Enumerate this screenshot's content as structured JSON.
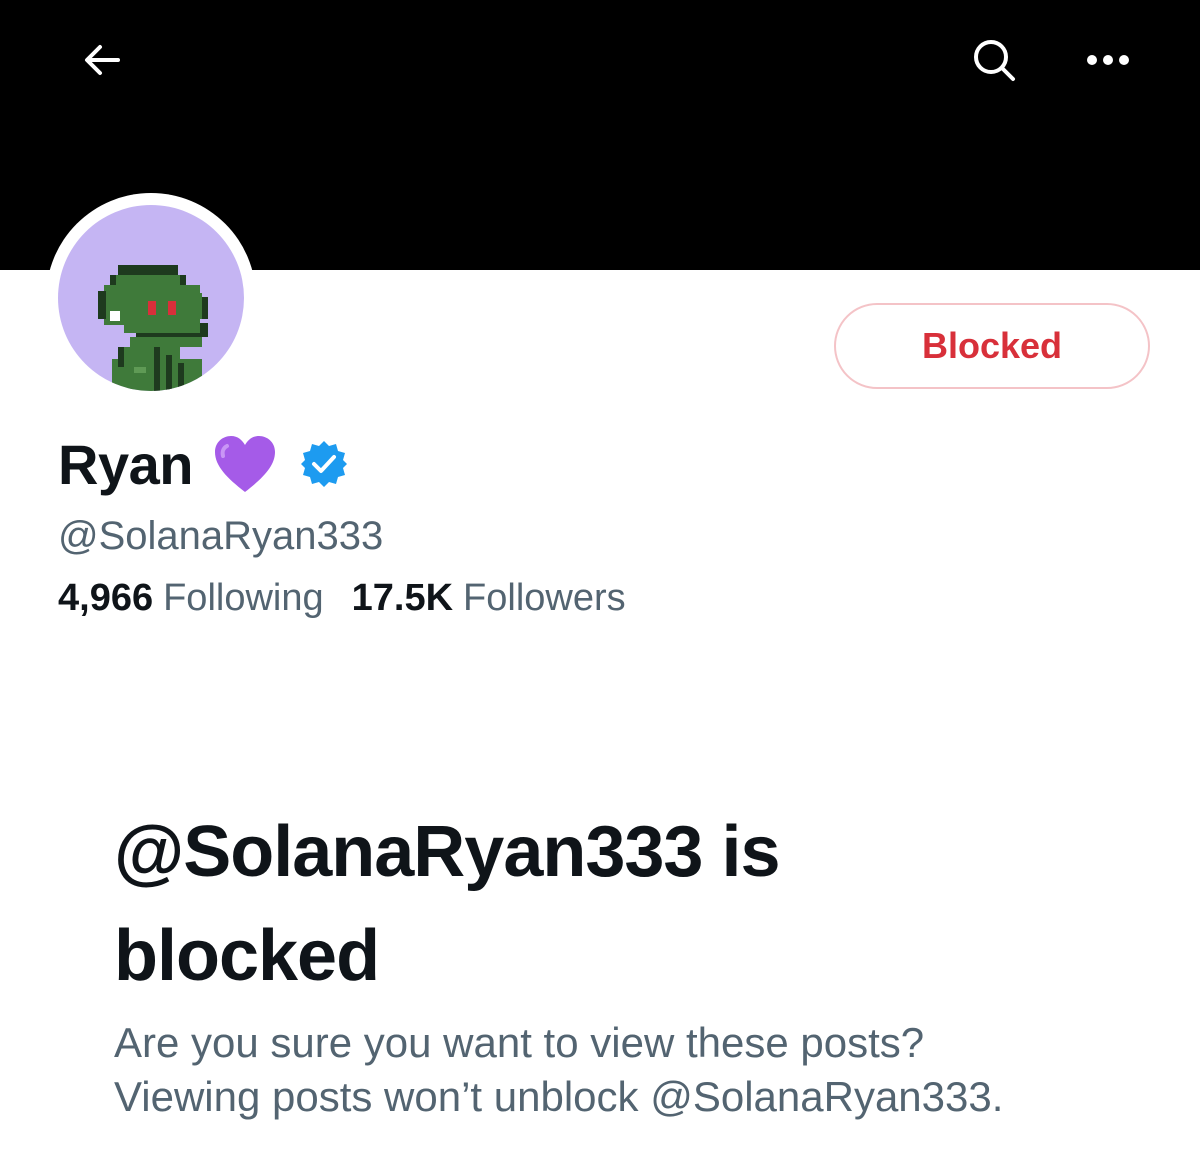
{
  "header": {
    "back_icon": "arrow-left-icon",
    "search_icon": "search-icon",
    "more_icon": "more-horizontal-icon",
    "banner_color": "#000000"
  },
  "profile": {
    "display_name": "Ryan",
    "emoji": "💜",
    "verified": true,
    "handle": "@SolanaRyan333",
    "following_count": "4,966",
    "following_label": "Following",
    "followers_count": "17.5K",
    "followers_label": "Followers",
    "avatar_background": "#c5b5f3"
  },
  "actions": {
    "blocked_label": "Blocked",
    "blocked_color": "#d8303a"
  },
  "blocked_notice": {
    "title": "@SolanaRyan333 is blocked",
    "line1": "Are you sure you want to view these posts?",
    "line2": "Viewing posts won’t unblock @SolanaRyan333."
  }
}
